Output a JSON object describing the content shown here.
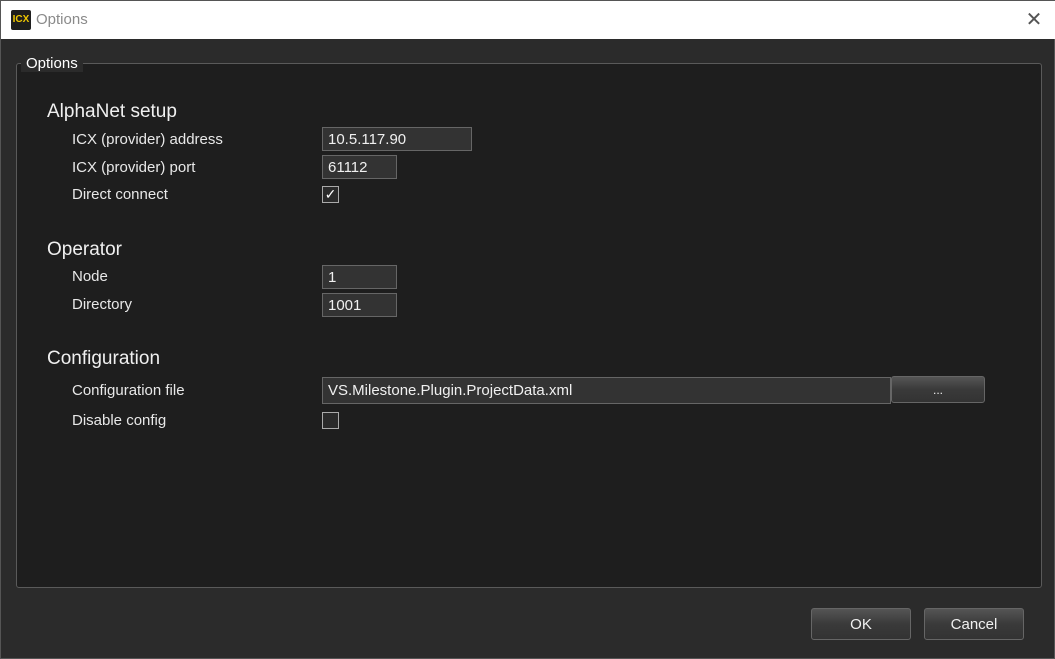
{
  "window": {
    "logo": "ICX",
    "title": "Options",
    "close": "✕"
  },
  "group": {
    "legend": "Options"
  },
  "alphanet": {
    "heading": "AlphaNet setup",
    "address_label": "ICX (provider) address",
    "address_value": "10.5.117.90",
    "port_label": "ICX (provider) port",
    "port_value": "61112",
    "direct_label": "Direct connect",
    "direct_checked": true,
    "check": "✓"
  },
  "operator": {
    "heading": "Operator",
    "node_label": "Node",
    "node_value": "1",
    "directory_label": "Directory",
    "directory_value": "1001"
  },
  "configuration": {
    "heading": "Configuration",
    "file_label": "Configuration file",
    "file_value": "VS.Milestone.Plugin.ProjectData.xml",
    "browse_label": "...",
    "disable_label": "Disable config",
    "disable_checked": false
  },
  "buttons": {
    "ok": "OK",
    "cancel": "Cancel"
  }
}
